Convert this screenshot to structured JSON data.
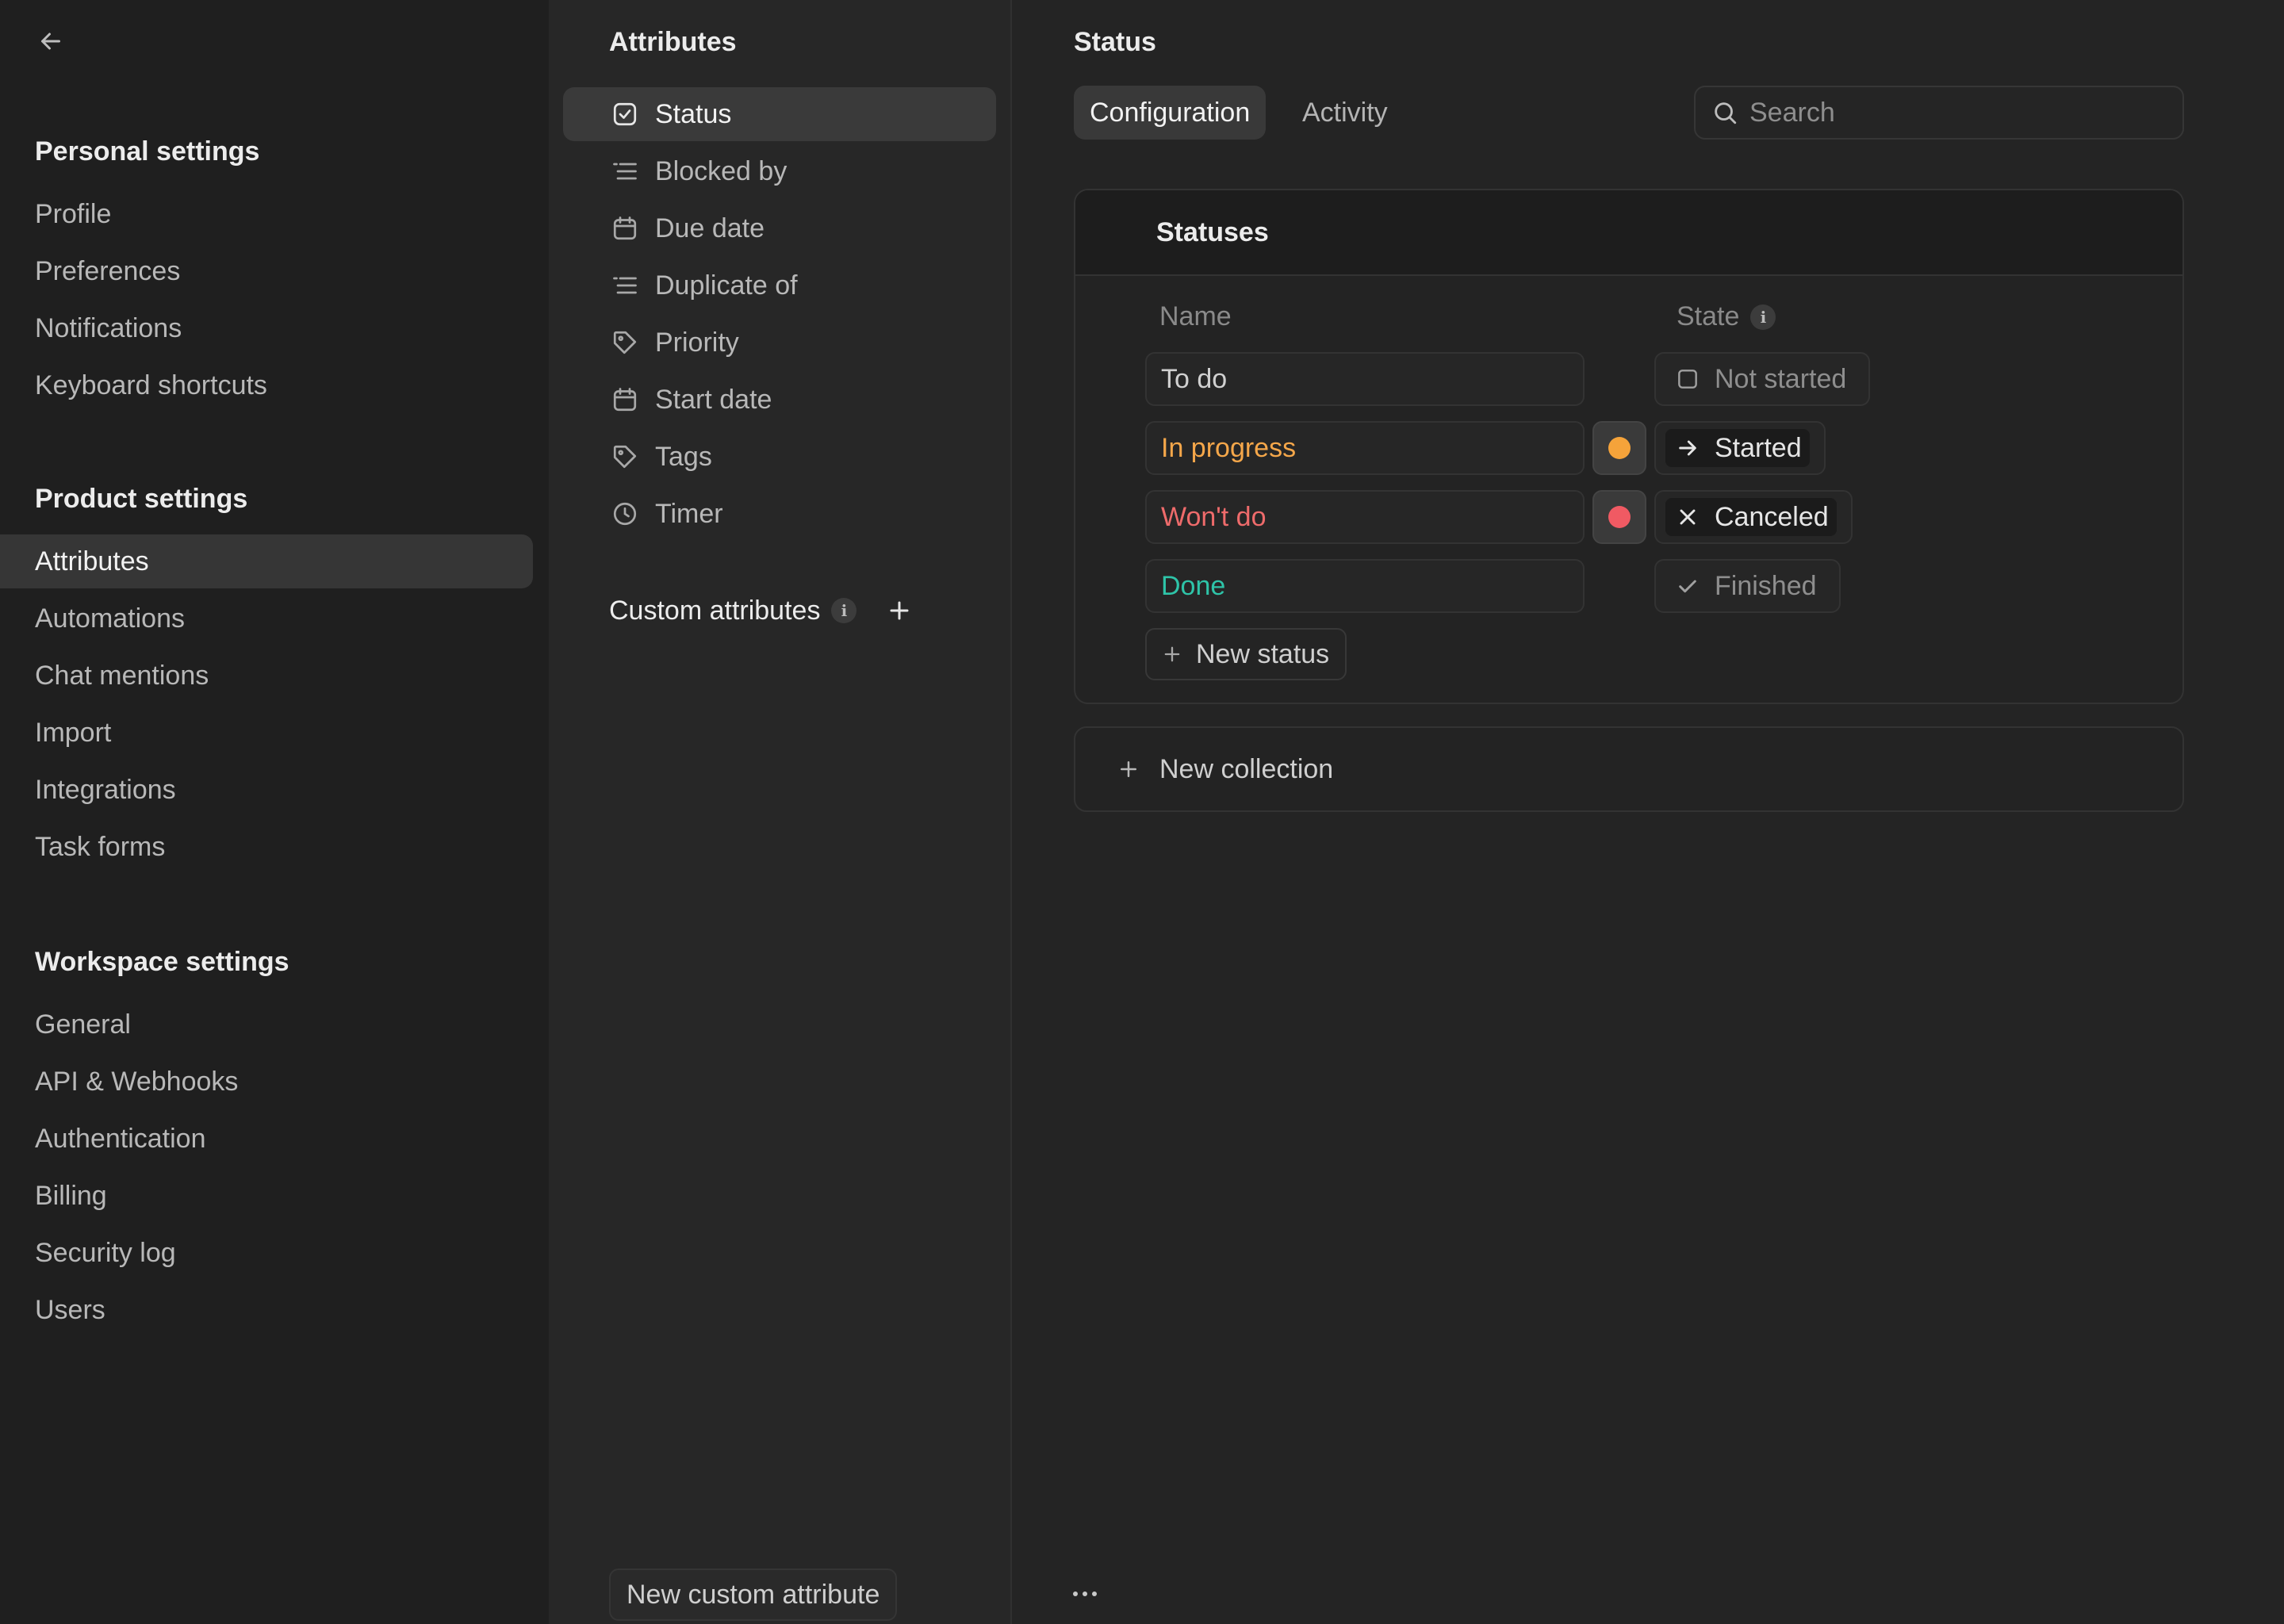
{
  "left_nav": {
    "personal_title": "Personal settings",
    "personal_items": [
      "Profile",
      "Preferences",
      "Notifications",
      "Keyboard shortcuts"
    ],
    "product_title": "Product settings",
    "product_items": [
      "Attributes",
      "Automations",
      "Chat mentions",
      "Import",
      "Integrations",
      "Task forms"
    ],
    "workspace_title": "Workspace settings",
    "workspace_items": [
      "General",
      "API & Webhooks",
      "Authentication",
      "Billing",
      "Security log",
      "Users"
    ],
    "active_item": "Attributes"
  },
  "attributes": {
    "title": "Attributes",
    "items": [
      {
        "label": "Status",
        "icon": "checkbox-icon"
      },
      {
        "label": "Blocked by",
        "icon": "list-icon"
      },
      {
        "label": "Due date",
        "icon": "calendar-icon"
      },
      {
        "label": "Duplicate of",
        "icon": "list-icon"
      },
      {
        "label": "Priority",
        "icon": "tag-icon"
      },
      {
        "label": "Start date",
        "icon": "calendar-icon"
      },
      {
        "label": "Tags",
        "icon": "tag-icon"
      },
      {
        "label": "Timer",
        "icon": "clock-icon"
      }
    ],
    "custom_label": "Custom attributes",
    "info_glyph": "i",
    "new_custom_label": "New custom attribute"
  },
  "main": {
    "title": "Status",
    "tabs": [
      "Configuration",
      "Activity"
    ],
    "active_tab": "Configuration",
    "search_placeholder": "Search",
    "card_title": "Statuses",
    "col_name": "Name",
    "col_state": "State",
    "statuses": [
      {
        "name": "To do",
        "text_color": "#d0d0d0",
        "dot_color": null,
        "state": "Not started",
        "state_icon": "empty-checkbox-icon",
        "state_color": "#8e8e8e"
      },
      {
        "name": "In progress",
        "text_color": "#f5a74a",
        "dot_color": "#f5a33a",
        "state": "Started",
        "state_icon": "arrow-right-icon",
        "state_color": "#e6e6e6"
      },
      {
        "name": "Won't do",
        "text_color": "#ee6b6b",
        "dot_color": "#f05a63",
        "state": "Canceled",
        "state_icon": "x-icon",
        "state_color": "#e6e6e6"
      },
      {
        "name": "Done",
        "text_color": "#2ec4a8",
        "dot_color": null,
        "state": "Finished",
        "state_icon": "check-icon",
        "state_color": "#8e8e8e"
      }
    ],
    "new_status_label": "New status",
    "new_collection_label": "New collection"
  }
}
